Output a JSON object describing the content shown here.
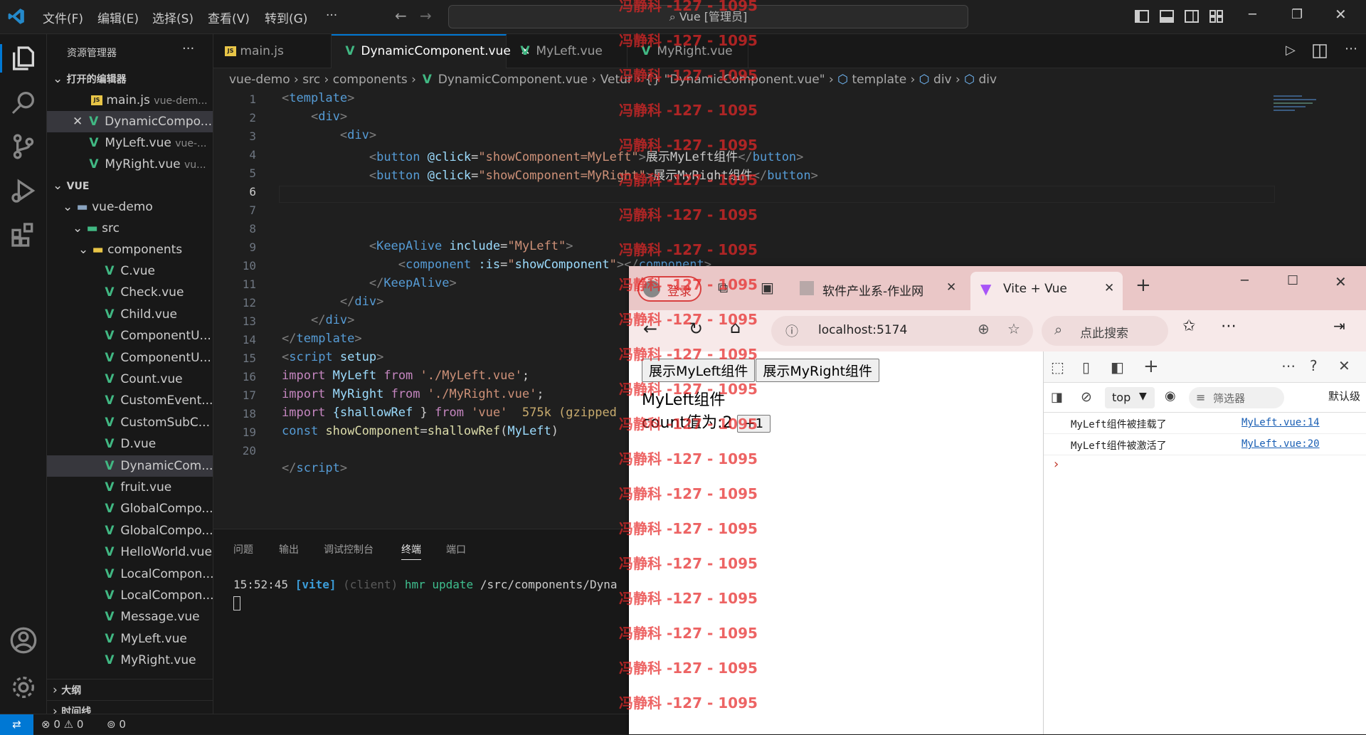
{
  "titlebar": {
    "menus": [
      "文件(F)",
      "编辑(E)",
      "选择(S)",
      "查看(V)",
      "转到(G)",
      "···"
    ],
    "search": "Vue [管理员]"
  },
  "sidebar": {
    "title": "资源管理器",
    "more": "···",
    "open_editors_label": "打开的编辑器",
    "open_editors": [
      {
        "name": "main.js",
        "hint": "vue-dem..."
      },
      {
        "name": "DynamicCompo...",
        "hint": ""
      },
      {
        "name": "MyLeft.vue",
        "hint": "vue-..."
      },
      {
        "name": "MyRight.vue",
        "hint": "vu..."
      }
    ],
    "workspace_label": "VUE",
    "folders": [
      "vue-demo",
      "src",
      "components"
    ],
    "files": [
      "C.vue",
      "Check.vue",
      "Child.vue",
      "ComponentU...",
      "ComponentU...",
      "Count.vue",
      "CustomEvent...",
      "CustomSubC...",
      "D.vue",
      "DynamicCom...",
      "fruit.vue",
      "GlobalCompo...",
      "GlobalCompo...",
      "HelloWorld.vue",
      "LocalCompon...",
      "LocalCompon...",
      "Message.vue",
      "MyLeft.vue",
      "MyRight.vue"
    ],
    "outline_label": "大纲",
    "timeline_label": "时间线"
  },
  "tabs": [
    "main.js",
    "DynamicComponent.vue",
    "MyLeft.vue",
    "MyRight.vue"
  ],
  "breadcrumb": [
    "vue-demo",
    "src",
    "components",
    "DynamicComponent.vue",
    "Vetur",
    "{} \"DynamicComponent.vue\"",
    "template",
    "div",
    "div"
  ],
  "editor": {
    "line_numbers": [
      "1",
      "2",
      "3",
      "4",
      "5",
      "6",
      "7",
      "8",
      "9",
      "10",
      "11",
      "12",
      "13",
      "14",
      "15",
      "16",
      "17",
      "18",
      "19",
      "20"
    ],
    "current_line": "6"
  },
  "panel": {
    "tabs": [
      "问题",
      "输出",
      "调试控制台",
      "终端",
      "端口"
    ],
    "terminal": {
      "time": "15:52:45",
      "vite": "[vite]",
      "client": "(client)",
      "hmr": "hmr update",
      "path": "/src/components/Dyna"
    }
  },
  "status": {
    "errors": "0",
    "warnings": "0",
    "ports": "0"
  },
  "watermark": "冯静科 -127 - 1095",
  "browser": {
    "login": "登录",
    "tab1_title": "软件产业系-作业网",
    "tab2_title": "Vite + Vue",
    "url": "localhost:5174",
    "search_hint": "点此搜索",
    "page": {
      "btn_left": "展示MyLeft组件",
      "btn_right": "展示MyRight组件",
      "heading": "MyLeft组件",
      "count_label": "count值为:2",
      "inc_button": "+1"
    },
    "devtools": {
      "context": "top",
      "filter": "筛选器",
      "levels": "默认级",
      "logs": [
        {
          "msg": "MyLeft组件被挂载了",
          "src": "MyLeft.vue:14"
        },
        {
          "msg": "MyLeft组件被激活了",
          "src": "MyLeft.vue:20"
        }
      ]
    }
  },
  "colors": {
    "accent": "#0078d4",
    "vue_green": "#41b883",
    "watermark": "#e62828"
  }
}
